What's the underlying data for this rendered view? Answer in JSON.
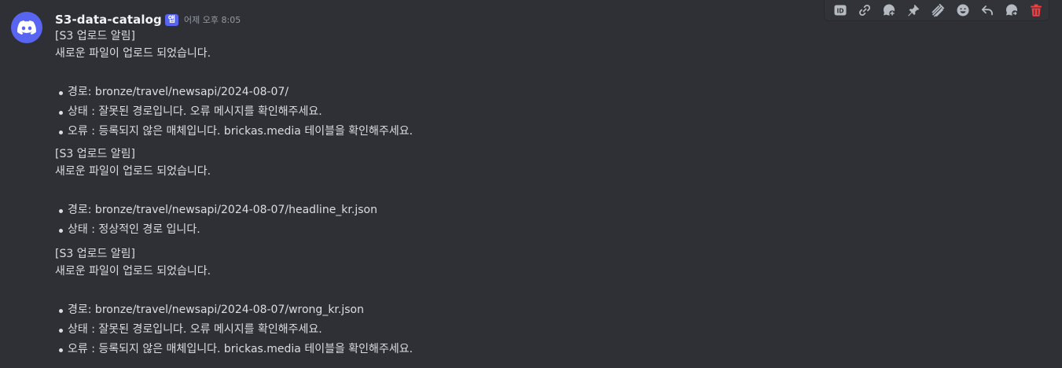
{
  "message": {
    "author": "S3-data-catalog",
    "app_badge": "앱",
    "timestamp": "어제 오후 8:05",
    "blocks": [
      {
        "title": "[S3 업로드 알림]",
        "subtitle": "새로운 파일이 업로드 되었습니다.",
        "items": [
          "경로: bronze/travel/newsapi/2024-08-07/",
          "상태 : 잘못된 경로입니다. 오류 메시지를 확인해주세요.",
          "오류 : 등록되지 않은 매체입니다. brickas.media 테이블을 확인해주세요."
        ]
      },
      {
        "title": "[S3 업로드 알림]",
        "subtitle": "새로운 파일이 업로드 되었습니다.",
        "items": [
          "경로: bronze/travel/newsapi/2024-08-07/headline_kr.json",
          "상태 : 정상적인 경로 입니다."
        ]
      },
      {
        "title": "[S3 업로드 알림]",
        "subtitle": "새로운 파일이 업로드 되었습니다.",
        "items": [
          "경로: bronze/travel/newsapi/2024-08-07/wrong_kr.json",
          "상태 : 잘못된 경로입니다. 오류 메시지를 확인해주세요.",
          "오류 : 등록되지 않은 매체입니다. brickas.media 테이블을 확인해주세요."
        ]
      }
    ]
  },
  "toolbar": {
    "icons": [
      "id-icon",
      "link-icon",
      "thread-icon",
      "pin-icon",
      "apps-icon",
      "emoji-icon",
      "reply-icon",
      "forward-icon",
      "trash-icon"
    ]
  },
  "colors": {
    "background": "#2e3035",
    "brand": "#5865f2",
    "danger": "#f23f43",
    "text": "#dbdee1",
    "muted": "#949ba4"
  }
}
